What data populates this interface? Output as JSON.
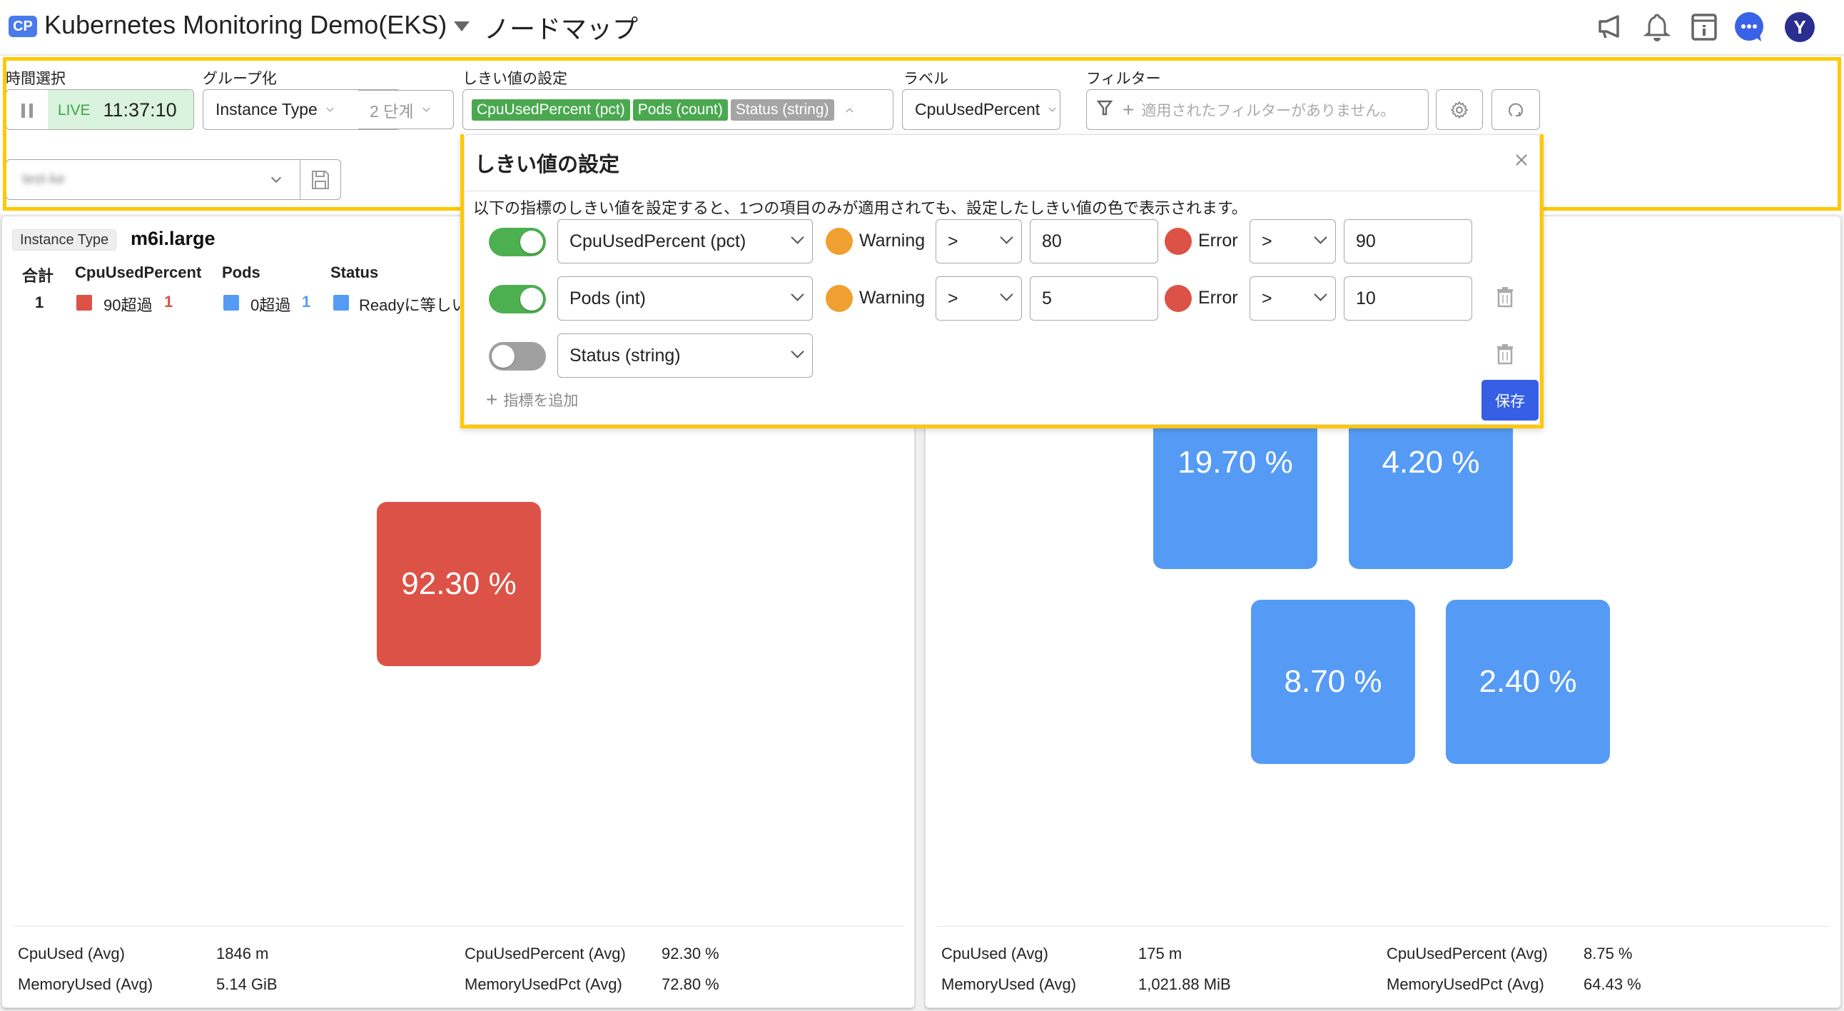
{
  "header": {
    "app_badge": "CP",
    "app_title": "Kubernetes Monitoring Demo(EKS)",
    "page_title": "ノードマップ",
    "icons": [
      "megaphone-icon",
      "bell-icon",
      "info-panel-icon",
      "chat-icon",
      "avatar"
    ],
    "avatar_initial": "Y",
    "colors": {
      "chat": "#3a62e8",
      "avatar": "#2a2f8f"
    }
  },
  "toolbar": {
    "time": {
      "label": "時間選択",
      "live_label": "LIVE",
      "time_value": "11:37:10"
    },
    "group": {
      "label": "グループ化",
      "value": "Instance Type",
      "depth": "2 단계"
    },
    "threshold": {
      "label": "しきい値の設定",
      "tags": [
        {
          "text": "CpuUsedPercent (pct)",
          "state": "active"
        },
        {
          "text": "Pods (count)",
          "state": "active"
        },
        {
          "text": "Status (string)",
          "state": "inactive"
        }
      ]
    },
    "label_select": {
      "label": "ラベル",
      "value": "CpuUsedPercent"
    },
    "filter": {
      "label": "フィルター",
      "placeholder": "適用されたフィルターがありません。"
    },
    "preset": {
      "value": "test-ke"
    }
  },
  "popover": {
    "title": "しきい値の設定",
    "description": "以下の指標のしきい値を設定すると、1つの項目のみが適用されても、設定したしきい値の色で表示されます。",
    "rows": [
      {
        "enabled": true,
        "metric": "CpuUsedPercent (pct)",
        "warning_label": "Warning",
        "warning_op": ">",
        "warning_value": "80",
        "error_label": "Error",
        "error_op": ">",
        "error_value": "90",
        "deletable": false
      },
      {
        "enabled": true,
        "metric": "Pods (int)",
        "warning_label": "Warning",
        "warning_op": ">",
        "warning_value": "5",
        "error_label": "Error",
        "error_op": ">",
        "error_value": "10",
        "deletable": true
      },
      {
        "enabled": false,
        "metric": "Status (string)",
        "deletable": true
      }
    ],
    "add_label": "指標を追加",
    "save_label": "保存",
    "colors": {
      "toggle_on": "#4caf50",
      "toggle_off": "#a0a0a0",
      "warning": "#f0a030",
      "error": "#dd5246",
      "save": "#365fe6"
    }
  },
  "left_panel": {
    "group_key": "Instance Type",
    "group_value": "m6i.large",
    "summary": {
      "headers": [
        "合計",
        "CpuUsedPercent",
        "Pods",
        "Status"
      ],
      "total": "1",
      "cpu": {
        "text": "90超過",
        "count": "1",
        "color": "#dd5246"
      },
      "pods": {
        "text": "0超過",
        "count": "1",
        "color": "#559bf5"
      },
      "status": {
        "text": "Readyに等しい",
        "color": "#559bf5"
      }
    },
    "tiles": [
      {
        "value": "92.30 %",
        "color": "#dd5246"
      }
    ],
    "stats": [
      {
        "label": "CpuUsed (Avg)",
        "value": "1846 m"
      },
      {
        "label": "CpuUsedPercent (Avg)",
        "value": "92.30 %"
      },
      {
        "label": "MemoryUsed (Avg)",
        "value": "5.14 GiB"
      },
      {
        "label": "MemoryUsedPct (Avg)",
        "value": "72.80 %"
      }
    ]
  },
  "right_panel": {
    "tiles": [
      {
        "value": "19.70 %",
        "color": "#559bf5"
      },
      {
        "value": "4.20 %",
        "color": "#559bf5"
      },
      {
        "value": "8.70 %",
        "color": "#559bf5"
      },
      {
        "value": "2.40 %",
        "color": "#559bf5"
      }
    ],
    "stats": [
      {
        "label": "CpuUsed (Avg)",
        "value": "175 m"
      },
      {
        "label": "CpuUsedPercent (Avg)",
        "value": "8.75 %"
      },
      {
        "label": "MemoryUsed (Avg)",
        "value": "1,021.88 MiB"
      },
      {
        "label": "MemoryUsedPct (Avg)",
        "value": "64.43 %"
      }
    ]
  }
}
